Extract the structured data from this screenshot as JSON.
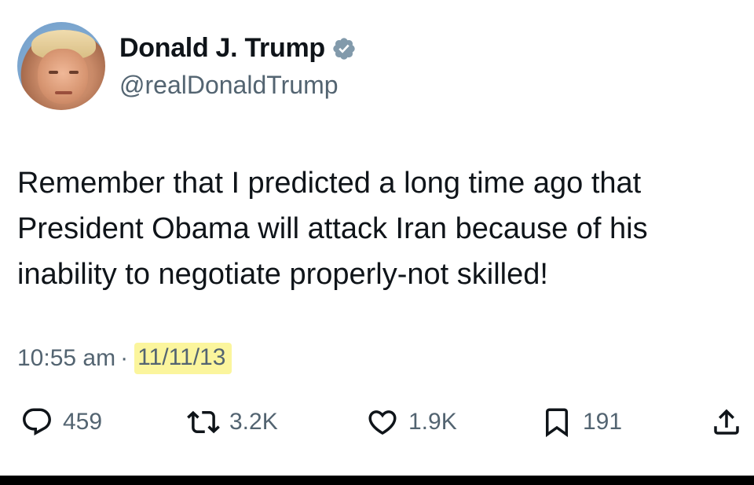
{
  "author": {
    "display_name": "Donald J. Trump",
    "handle": "@realDonaldTrump",
    "verified_badge_icon": "verified-badge-icon",
    "verified_color": "#829aab"
  },
  "tweet": {
    "text": "Remember that I predicted a long time ago that President Obama will attack Iran because of his inability to negotiate properly-not skilled!",
    "time": "10:55 am",
    "separator": "·",
    "date": "11/11/13",
    "date_highlight_color": "#fbf59d"
  },
  "actions": {
    "reply": {
      "icon": "reply-icon",
      "count": "459"
    },
    "retweet": {
      "icon": "retweet-icon",
      "count": "3.2K"
    },
    "like": {
      "icon": "heart-icon",
      "count": "1.9K"
    },
    "bookmark": {
      "icon": "bookmark-icon",
      "count": "191"
    },
    "share": {
      "icon": "share-icon"
    }
  },
  "colors": {
    "text": "#0f1419",
    "secondary_text": "#536471",
    "background": "#ffffff"
  }
}
